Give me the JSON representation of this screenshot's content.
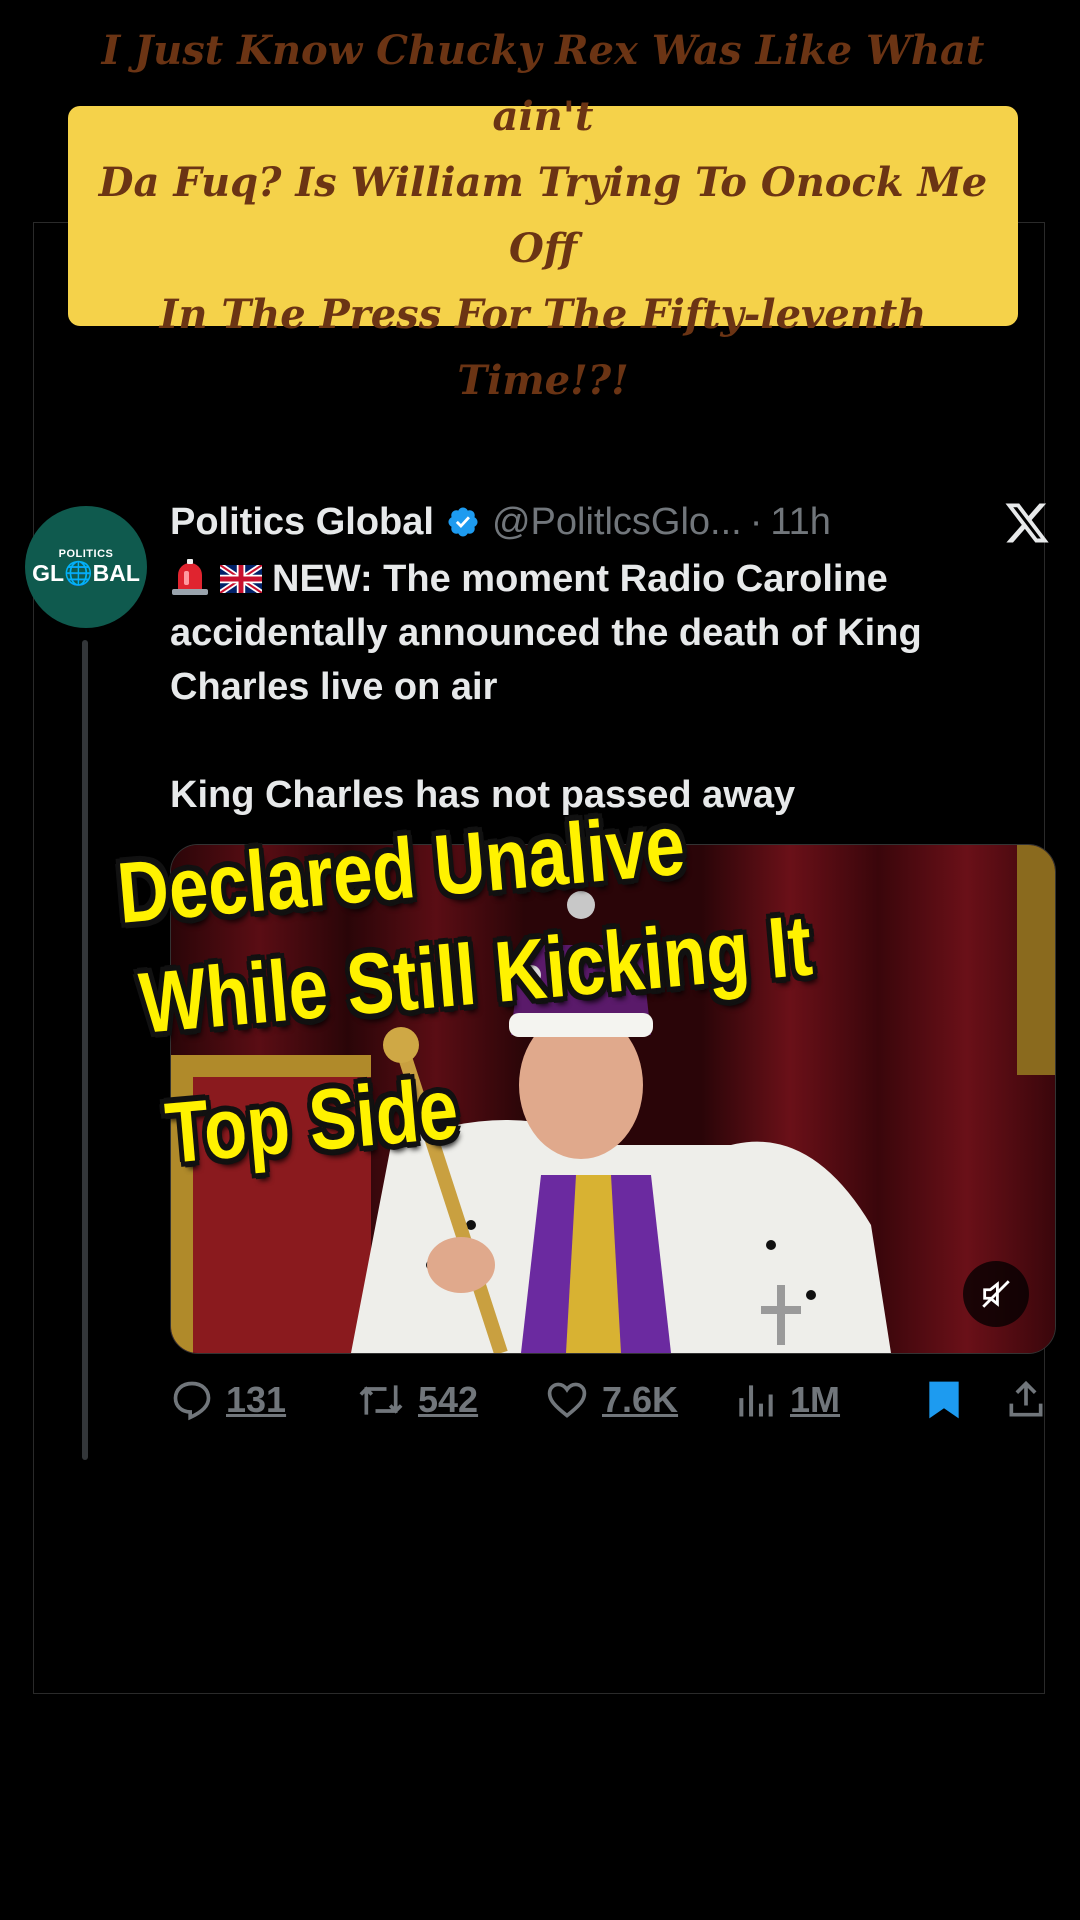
{
  "caption": {
    "lines": [
      "I Just Know Chucky Rex Was Like What ain't",
      "Da Fuq? Is William Trying To Onock Me Off",
      "In The Press For The Fifty-leventh Time!?!"
    ]
  },
  "avatar": {
    "label_small": "POLITICS",
    "label_big": "GL🌐BAL"
  },
  "tweet": {
    "display_name": "Politics Global",
    "handle": "@PolitlcsGlo...",
    "separator": "·",
    "time": "11h",
    "body_line1": "NEW: The moment Radio Caroline",
    "body_line2": "accidentally announced the death of King",
    "body_line3": "Charles live on air",
    "body_line4": "King Charles has not passed away"
  },
  "overlay": {
    "line1": "Declared Unalive",
    "line2": "While Still Kicking It",
    "line3": "Top Side"
  },
  "actions": {
    "replies": "131",
    "reposts": "542",
    "likes": "7.6K",
    "views": "1M"
  },
  "colors": {
    "caption_bg": "#f5d24a",
    "caption_text": "#6b3414",
    "overlay_text": "#fff200",
    "bookmark_active": "#1d9bf0",
    "verified_badge": "#1d9bf0",
    "muted_text": "#71767b"
  },
  "icons": [
    "siren-emoji",
    "uk-flag-emoji",
    "verified-badge-icon",
    "x-logo-icon",
    "reply-icon",
    "repost-icon",
    "like-icon",
    "views-icon",
    "bookmark-icon",
    "share-icon",
    "mute-icon"
  ]
}
